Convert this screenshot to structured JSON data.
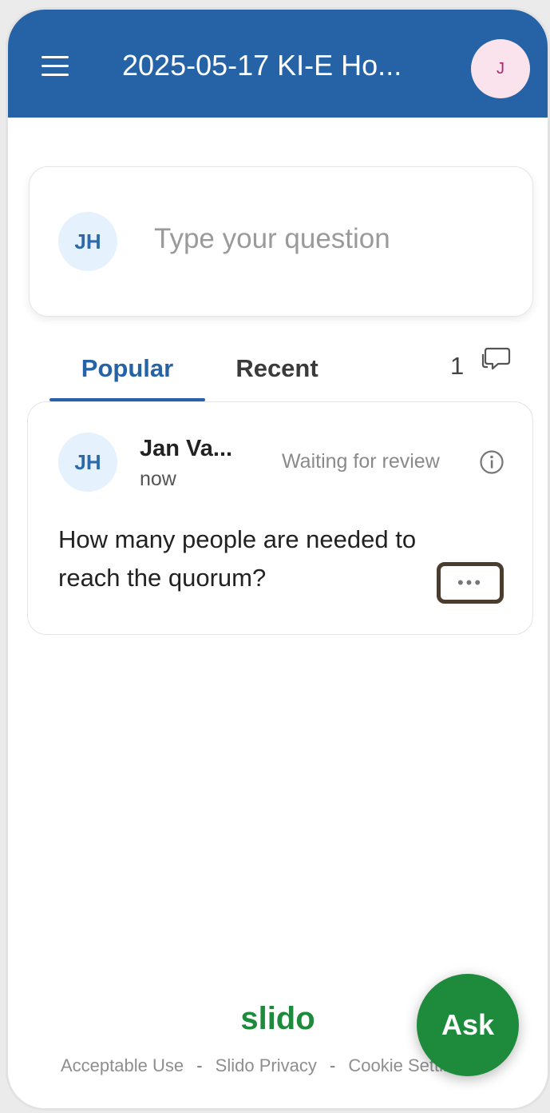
{
  "header": {
    "title": "2025-05-17 KI-E Ho...",
    "avatar_initial": "J",
    "menu_icon": "hamburger-menu-icon"
  },
  "ask_box": {
    "avatar_initials": "JH",
    "placeholder": "Type your question"
  },
  "tabs": [
    {
      "label": "Popular",
      "active": true
    },
    {
      "label": "Recent",
      "active": false
    }
  ],
  "question_count": "1",
  "questions": [
    {
      "avatar_initials": "JH",
      "author": "Jan Va...",
      "time": "now",
      "status": "Waiting for review",
      "text": "How many people are needed to reach the quorum?",
      "more_label": "•••"
    }
  ],
  "footer": {
    "logo": "slido",
    "links": [
      "Acceptable Use",
      "Slido Privacy",
      "Cookie Settings"
    ],
    "separator": "-"
  },
  "ask_button_label": "Ask",
  "colors": {
    "header_bg": "#2563a6",
    "accent_blue": "#2563a6",
    "ask_green": "#1e8a3c",
    "avatar_bg": "#e5f1fd",
    "user_avatar_bg": "#fbe3ee"
  }
}
